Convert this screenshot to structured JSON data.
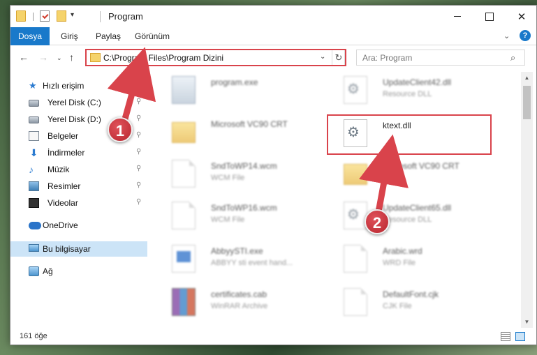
{
  "window": {
    "title": "Program",
    "quick_access_dropdown": "▾"
  },
  "ribbon": {
    "tabs": [
      {
        "label": "Dosya"
      },
      {
        "label": "Giriş"
      },
      {
        "label": "Paylaş"
      },
      {
        "label": "Görünüm"
      }
    ],
    "expand_chevron": "⌄",
    "help": "?"
  },
  "nav": {
    "back": "←",
    "forward": "→",
    "recent": "⌄",
    "up": "↑"
  },
  "address": {
    "path": "C:\\Program Files\\Program Dizini",
    "dropdown": "⌄",
    "refresh": "↻"
  },
  "search": {
    "placeholder": "Ara: Program",
    "icon": "⌕"
  },
  "sidebar": {
    "items": [
      {
        "label": "Hızlı erişim",
        "icon": "star-icon",
        "pinned": false
      },
      {
        "label": "Yerel Disk (C:)",
        "icon": "drive-icon",
        "pinned": true
      },
      {
        "label": "Yerel Disk (D:)",
        "icon": "drive-icon",
        "pinned": true
      },
      {
        "label": "Belgeler",
        "icon": "documents-icon",
        "pinned": true
      },
      {
        "label": "İndirmeler",
        "icon": "downloads-icon",
        "pinned": true
      },
      {
        "label": "Müzik",
        "icon": "music-icon",
        "pinned": true
      },
      {
        "label": "Resimler",
        "icon": "pictures-icon",
        "pinned": true
      },
      {
        "label": "Videolar",
        "icon": "videos-icon",
        "pinned": true
      },
      {
        "label": "OneDrive",
        "icon": "onedrive-icon",
        "pinned": false
      },
      {
        "label": "Bu bilgisayar",
        "icon": "computer-icon",
        "pinned": false,
        "selected": true
      },
      {
        "label": "Ağ",
        "icon": "network-icon",
        "pinned": false
      }
    ],
    "pin_glyph": "📌"
  },
  "files": [
    {
      "name": "program.exe",
      "type": "",
      "icon": "exe-icon"
    },
    {
      "name": "UpdateClient42.dll",
      "type": "Resource DLL",
      "icon": "dll-gear-icon"
    },
    {
      "name": "Microsoft VC90 CRT",
      "type": "",
      "icon": "folder-icon"
    },
    {
      "name": "ktext.dll",
      "type": "",
      "icon": "dll-gear-icon",
      "highlighted": true
    },
    {
      "name": "SndToWP14.wcm",
      "type": "WCM File",
      "icon": "file-icon"
    },
    {
      "name": "Microsoft VC90 CRT",
      "type": "",
      "icon": "folder-icon"
    },
    {
      "name": "SndToWP16.wcm",
      "type": "WCM File",
      "icon": "file-icon"
    },
    {
      "name": "UpdateClient65.dll",
      "type": "Resource DLL",
      "icon": "dll-gear-icon"
    },
    {
      "name": "AbbyySTI.exe",
      "type": "ABBYY sti event hand...",
      "icon": "app-icon"
    },
    {
      "name": "Arabic.wrd",
      "type": "WRD File",
      "icon": "file-icon"
    },
    {
      "name": "certificates.cab",
      "type": "WinRAR Archive",
      "icon": "rar-icon"
    },
    {
      "name": "DefaultFont.cjk",
      "type": "CJK File",
      "icon": "file-icon"
    }
  ],
  "status": {
    "item_count": "161 öğe"
  },
  "annotations": {
    "step1": "1",
    "step2": "2",
    "color": "#d9434b"
  },
  "colors": {
    "accent": "#1979ca",
    "selection": "#cce4f7",
    "highlight": "#d9434b"
  }
}
